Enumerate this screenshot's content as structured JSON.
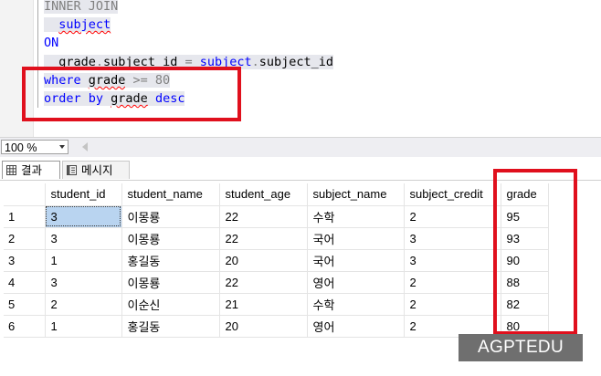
{
  "editor": {
    "lines": [
      {
        "tokens": [
          {
            "t": "INNER JOIN",
            "c": "id-gray sel"
          }
        ]
      },
      {
        "tokens": [
          {
            "t": "  ",
            "c": "sel"
          },
          {
            "t": "subject",
            "c": "kw sel sq"
          }
        ]
      },
      {
        "tokens": [
          {
            "t": "ON",
            "c": "kw"
          }
        ]
      },
      {
        "tokens": [
          {
            "t": "  grade",
            "c": "plain sel"
          },
          {
            "t": ".",
            "c": "op sel"
          },
          {
            "t": "subject_id",
            "c": "plain sel"
          },
          {
            "t": " = ",
            "c": "op sel"
          },
          {
            "t": "subject",
            "c": "kw sel"
          },
          {
            "t": ".",
            "c": "op sel"
          },
          {
            "t": "subject_id",
            "c": "plain sel"
          }
        ]
      },
      {
        "tokens": [
          {
            "t": "where",
            "c": "kw sel"
          },
          {
            "t": " ",
            "c": "sel"
          },
          {
            "t": "grade",
            "c": "plain sel sq"
          },
          {
            "t": " >= 80",
            "c": "op sel"
          }
        ]
      },
      {
        "tokens": [
          {
            "t": "order by",
            "c": "kw sel"
          },
          {
            "t": " ",
            "c": "sel"
          },
          {
            "t": "grade",
            "c": "plain sel sq"
          },
          {
            "t": " ",
            "c": "sel"
          },
          {
            "t": "desc",
            "c": "kw sel"
          }
        ]
      }
    ]
  },
  "zoom": {
    "value": "100 %"
  },
  "tabs": {
    "results": "결과",
    "messages": "메시지"
  },
  "grid": {
    "columns": [
      "student_id",
      "student_name",
      "student_age",
      "subject_name",
      "subject_credit",
      "grade"
    ],
    "rows": [
      {
        "n": "1",
        "cells": [
          "3",
          "이몽룡",
          "22",
          "수학",
          "2",
          "95"
        ]
      },
      {
        "n": "2",
        "cells": [
          "3",
          "이몽룡",
          "22",
          "국어",
          "3",
          "93"
        ]
      },
      {
        "n": "3",
        "cells": [
          "1",
          "홍길동",
          "20",
          "국어",
          "3",
          "90"
        ]
      },
      {
        "n": "4",
        "cells": [
          "3",
          "이몽룡",
          "22",
          "영어",
          "2",
          "88"
        ]
      },
      {
        "n": "5",
        "cells": [
          "2",
          "이순신",
          "21",
          "수학",
          "2",
          "82"
        ]
      },
      {
        "n": "6",
        "cells": [
          "1",
          "홍길동",
          "20",
          "영어",
          "2",
          "80"
        ]
      }
    ]
  },
  "watermark": "AGPTEDU",
  "colors": {
    "keyword": "#0000ff",
    "highlight": "#e0101d",
    "selected_cell": "#b9d4f0"
  }
}
